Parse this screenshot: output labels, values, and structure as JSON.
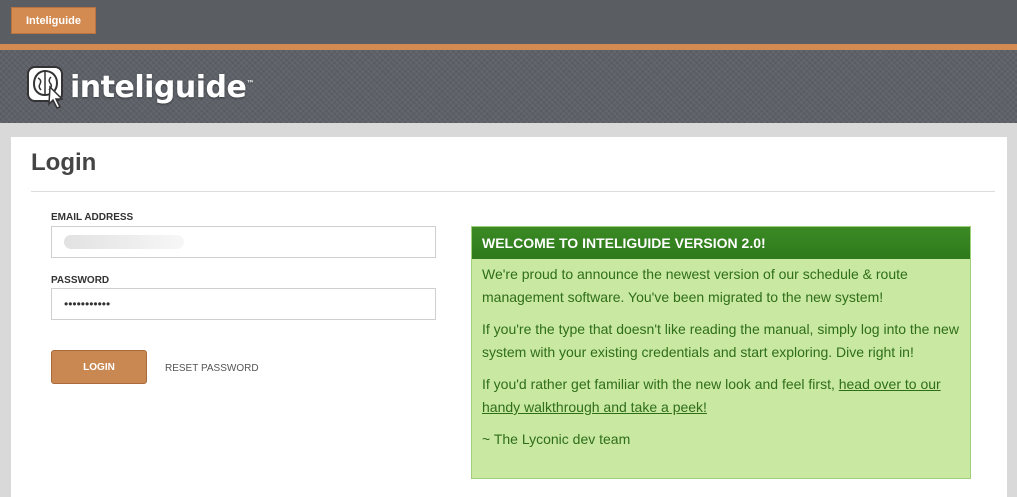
{
  "topbar": {
    "app_tab_label": "Inteliguide"
  },
  "header": {
    "logo_text": "inteliguide",
    "logo_tm": "™"
  },
  "login": {
    "title": "Login",
    "email_label": "EMAIL ADDRESS",
    "password_label": "PASSWORD",
    "password_value": "•••••••••••",
    "login_button": "LOGIN",
    "reset_link": "RESET PASSWORD"
  },
  "welcome": {
    "title": "WELCOME TO INTELIGUIDE VERSION 2.0!",
    "para1": "We're proud to announce the newest version of our schedule & route management software. You've been migrated to the new system!",
    "para2": "If you're the type that doesn't like reading the manual, simply log into the new system with your existing credentials and start exploring. Dive right in!",
    "para3_prefix": "If you'd rather get familiar with the new look and feel first, ",
    "para3_link": "head over to our handy walkthrough and take a peek!",
    "signature": "~ The Lyconic dev team"
  },
  "colors": {
    "accent_orange": "#d38b52",
    "header_gray": "#5e6268",
    "welcome_green": "#3b8a24",
    "welcome_bg": "#c9e8a1"
  },
  "icons": {
    "logo": "brain-cursor-logo-icon"
  }
}
